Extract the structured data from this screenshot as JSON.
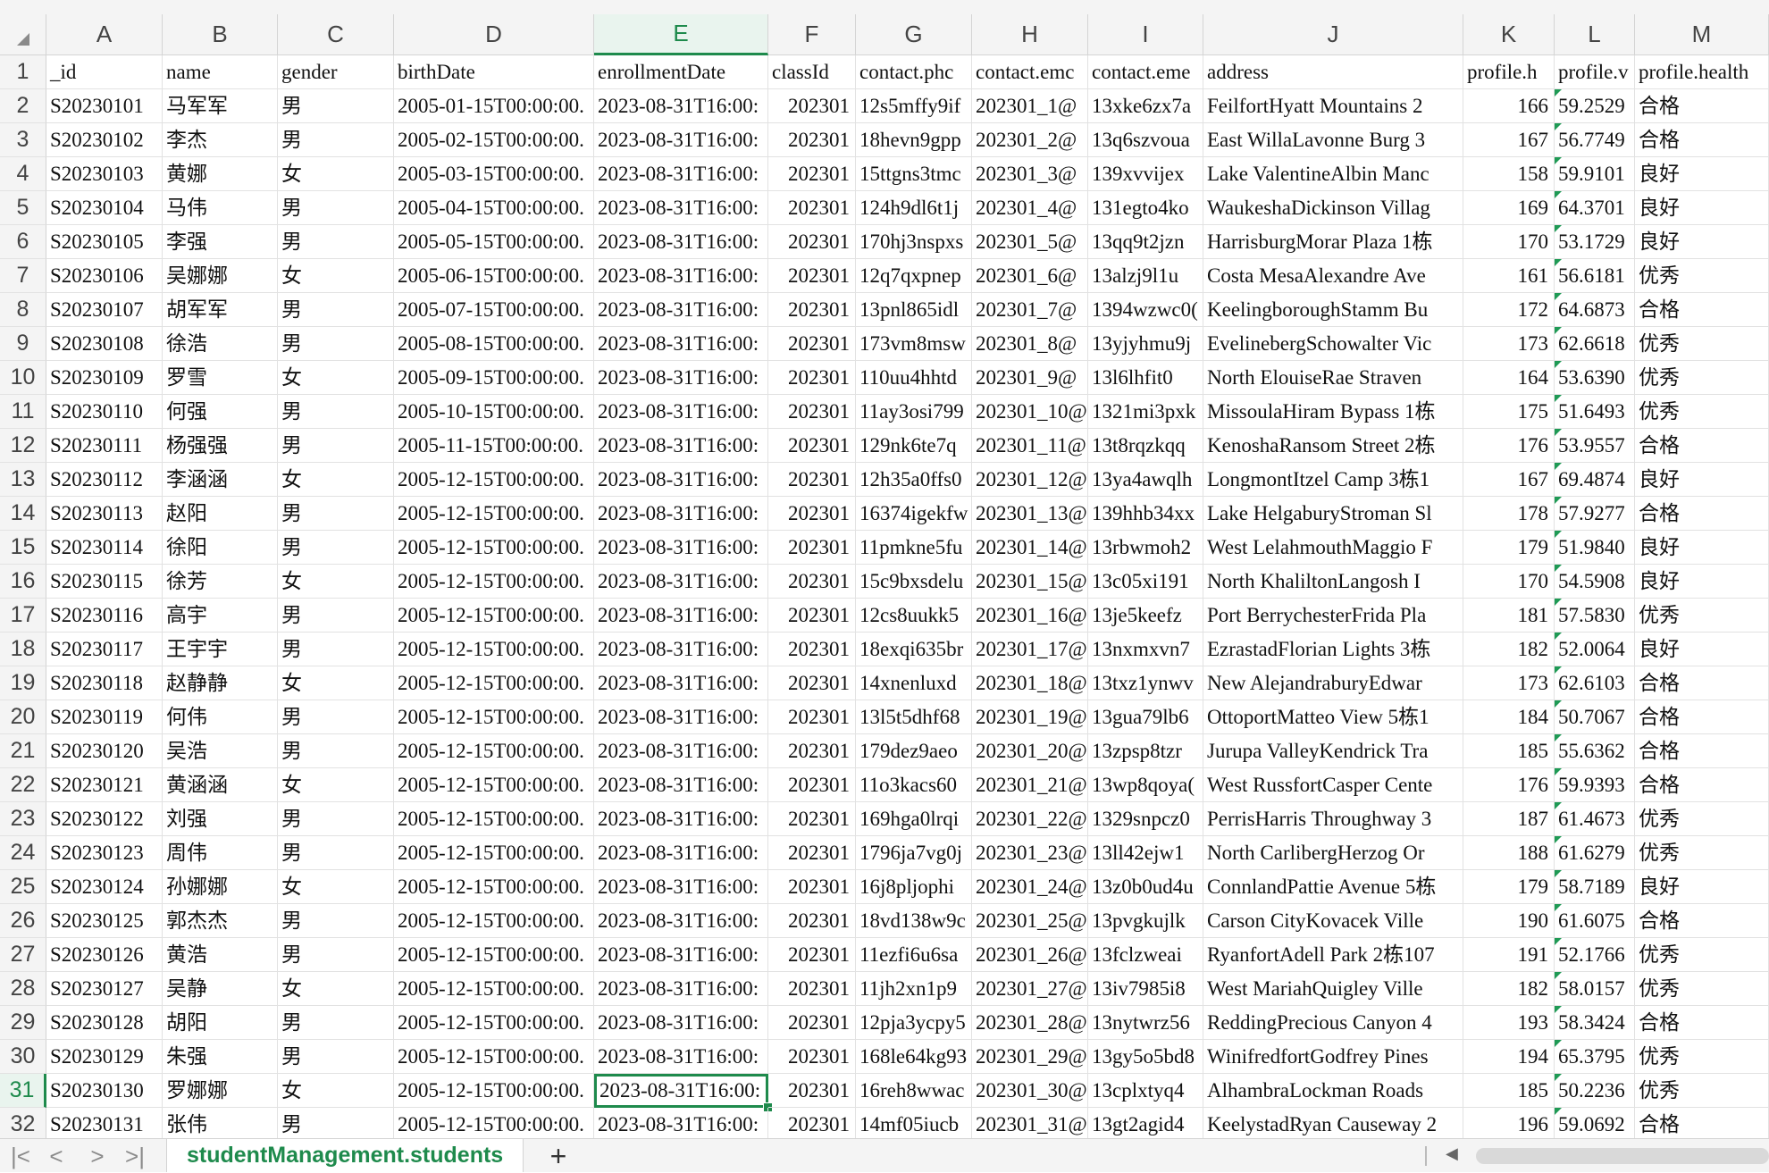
{
  "columns": [
    "A",
    "B",
    "C",
    "D",
    "E",
    "F",
    "G",
    "H",
    "I",
    "J",
    "K",
    "L",
    "M"
  ],
  "selected_column": "E",
  "selected_row": "31",
  "header_row": {
    "row_number": "1",
    "values": [
      "_id",
      "name",
      "gender",
      "birthDate",
      "enrollmentDate",
      "classId",
      "contact.phc",
      "contact.emc",
      "contact.eme",
      "address",
      "profile.h",
      "profile.v",
      "profile.health"
    ]
  },
  "rows": [
    {
      "n": "2",
      "v": [
        "S20230101",
        "马军军",
        "男",
        "2005-01-15T00:00:00.",
        "2023-08-31T16:00:",
        "202301",
        "12s5mffy9if",
        "202301_1@",
        "13xke6zx7a",
        "FeilfortHyatt Mountains 2",
        "166",
        "59.2529",
        "合格"
      ]
    },
    {
      "n": "3",
      "v": [
        "S20230102",
        "李杰",
        "男",
        "2005-02-15T00:00:00.",
        "2023-08-31T16:00:",
        "202301",
        "18hevn9gpp",
        "202301_2@",
        "13q6szvoua",
        "East WillaLavonne Burg 3",
        "167",
        "56.7749",
        "合格"
      ]
    },
    {
      "n": "4",
      "v": [
        "S20230103",
        "黄娜",
        "女",
        "2005-03-15T00:00:00.",
        "2023-08-31T16:00:",
        "202301",
        "15ttgns3tmc",
        "202301_3@",
        "139xvvijex",
        "Lake ValentineAlbin Manc",
        "158",
        "59.9101",
        "良好"
      ]
    },
    {
      "n": "5",
      "v": [
        "S20230104",
        "马伟",
        "男",
        "2005-04-15T00:00:00.",
        "2023-08-31T16:00:",
        "202301",
        "124h9dl6t1j",
        "202301_4@",
        "131egto4ko",
        "WaukeshaDickinson Villag",
        "169",
        "64.3701",
        "良好"
      ]
    },
    {
      "n": "6",
      "v": [
        "S20230105",
        "李强",
        "男",
        "2005-05-15T00:00:00.",
        "2023-08-31T16:00:",
        "202301",
        "170hj3nspxs",
        "202301_5@",
        "13qq9t2jzn",
        "HarrisburgMorar Plaza 1栋",
        "170",
        "53.1729",
        "良好"
      ]
    },
    {
      "n": "7",
      "v": [
        "S20230106",
        "吴娜娜",
        "女",
        "2005-06-15T00:00:00.",
        "2023-08-31T16:00:",
        "202301",
        "12q7qxpnep",
        "202301_6@",
        "13alzj9l1u",
        "Costa MesaAlexandre Ave",
        "161",
        "56.6181",
        "优秀"
      ]
    },
    {
      "n": "8",
      "v": [
        "S20230107",
        "胡军军",
        "男",
        "2005-07-15T00:00:00.",
        "2023-08-31T16:00:",
        "202301",
        "13pnl865idl",
        "202301_7@",
        "1394wzwc0(",
        "KeelingboroughStamm Bu",
        "172",
        "64.6873",
        "合格"
      ]
    },
    {
      "n": "9",
      "v": [
        "S20230108",
        "徐浩",
        "男",
        "2005-08-15T00:00:00.",
        "2023-08-31T16:00:",
        "202301",
        "173vm8msw",
        "202301_8@",
        "13yjyhmu9j",
        "EvelinebergSchowalter Vic",
        "173",
        "62.6618",
        "优秀"
      ]
    },
    {
      "n": "10",
      "v": [
        "S20230109",
        "罗雪",
        "女",
        "2005-09-15T00:00:00.",
        "2023-08-31T16:00:",
        "202301",
        "110uu4hhtd",
        "202301_9@",
        "13l6lhfit0",
        "North ElouiseRae Straven",
        "164",
        "53.6390",
        "优秀"
      ]
    },
    {
      "n": "11",
      "v": [
        "S20230110",
        "何强",
        "男",
        "2005-10-15T00:00:00.",
        "2023-08-31T16:00:",
        "202301",
        "11ay3osi799",
        "202301_10@",
        "1321mi3pxk",
        "MissoulaHiram Bypass 1栋",
        "175",
        "51.6493",
        "优秀"
      ]
    },
    {
      "n": "12",
      "v": [
        "S20230111",
        "杨强强",
        "男",
        "2005-11-15T00:00:00.",
        "2023-08-31T16:00:",
        "202301",
        "129nk6te7q",
        "202301_11@",
        "13t8rqzkqq",
        "KenoshaRansom Street 2栋",
        "176",
        "53.9557",
        "合格"
      ]
    },
    {
      "n": "13",
      "v": [
        "S20230112",
        "李涵涵",
        "女",
        "2005-12-15T00:00:00.",
        "2023-08-31T16:00:",
        "202301",
        "12h35a0ffs0",
        "202301_12@",
        "13ya4awqlh",
        "LongmontItzel Camp 3栋1",
        "167",
        "69.4874",
        "良好"
      ]
    },
    {
      "n": "14",
      "v": [
        "S20230113",
        "赵阳",
        "男",
        "2005-12-15T00:00:00.",
        "2023-08-31T16:00:",
        "202301",
        "16374igekfw",
        "202301_13@",
        "139hhb34xx",
        "Lake HelgaburyStroman Sl",
        "178",
        "57.9277",
        "合格"
      ]
    },
    {
      "n": "15",
      "v": [
        "S20230114",
        "徐阳",
        "男",
        "2005-12-15T00:00:00.",
        "2023-08-31T16:00:",
        "202301",
        "11pmkne5fu",
        "202301_14@",
        "13rbwmoh2",
        "West LelahmouthMaggio F",
        "179",
        "51.9840",
        "良好"
      ]
    },
    {
      "n": "16",
      "v": [
        "S20230115",
        "徐芳",
        "女",
        "2005-12-15T00:00:00.",
        "2023-08-31T16:00:",
        "202301",
        "15c9bxsdelu",
        "202301_15@",
        "13c05xi191",
        "North KhaliltonLangosh I",
        "170",
        "54.5908",
        "良好"
      ]
    },
    {
      "n": "17",
      "v": [
        "S20230116",
        "高宇",
        "男",
        "2005-12-15T00:00:00.",
        "2023-08-31T16:00:",
        "202301",
        "12cs8uukk5",
        "202301_16@",
        "13je5keefz",
        "Port BerrychesterFrida Pla",
        "181",
        "57.5830",
        "优秀"
      ]
    },
    {
      "n": "18",
      "v": [
        "S20230117",
        "王宇宇",
        "男",
        "2005-12-15T00:00:00.",
        "2023-08-31T16:00:",
        "202301",
        "18exqi635br",
        "202301_17@",
        "13nxmxvn7",
        "EzrastadFlorian Lights 3栋",
        "182",
        "52.0064",
        "良好"
      ]
    },
    {
      "n": "19",
      "v": [
        "S20230118",
        "赵静静",
        "女",
        "2005-12-15T00:00:00.",
        "2023-08-31T16:00:",
        "202301",
        "14xnenluxd",
        "202301_18@",
        "13txz1ynwv",
        "New AlejandraburyEdwar",
        "173",
        "62.6103",
        "合格"
      ]
    },
    {
      "n": "20",
      "v": [
        "S20230119",
        "何伟",
        "男",
        "2005-12-15T00:00:00.",
        "2023-08-31T16:00:",
        "202301",
        "13l5t5dhf68",
        "202301_19@",
        "13gua79lb6",
        "OttoportMatteo View 5栋1",
        "184",
        "50.7067",
        "合格"
      ]
    },
    {
      "n": "21",
      "v": [
        "S20230120",
        "吴浩",
        "男",
        "2005-12-15T00:00:00.",
        "2023-08-31T16:00:",
        "202301",
        "179dez9aeo",
        "202301_20@",
        "13zpsp8tzr",
        "Jurupa ValleyKendrick Tra",
        "185",
        "55.6362",
        "合格"
      ]
    },
    {
      "n": "22",
      "v": [
        "S20230121",
        "黄涵涵",
        "女",
        "2005-12-15T00:00:00.",
        "2023-08-31T16:00:",
        "202301",
        "11o3kacs60",
        "202301_21@",
        "13wp8qoya(",
        "West RussfortCasper Cente",
        "176",
        "59.9393",
        "合格"
      ]
    },
    {
      "n": "23",
      "v": [
        "S20230122",
        "刘强",
        "男",
        "2005-12-15T00:00:00.",
        "2023-08-31T16:00:",
        "202301",
        "169hga0lrqi",
        "202301_22@",
        "1329snpcz0",
        "PerrisHarris Throughway 3",
        "187",
        "61.4673",
        "优秀"
      ]
    },
    {
      "n": "24",
      "v": [
        "S20230123",
        "周伟",
        "男",
        "2005-12-15T00:00:00.",
        "2023-08-31T16:00:",
        "202301",
        "1796ja7vg0j",
        "202301_23@",
        "13ll42ejw1",
        "North CarlibergHerzog Or",
        "188",
        "61.6279",
        "优秀"
      ]
    },
    {
      "n": "25",
      "v": [
        "S20230124",
        "孙娜娜",
        "女",
        "2005-12-15T00:00:00.",
        "2023-08-31T16:00:",
        "202301",
        "16j8pljophi",
        "202301_24@",
        "13z0b0ud4u",
        "ConnlandPattie Avenue 5栋",
        "179",
        "58.7189",
        "良好"
      ]
    },
    {
      "n": "26",
      "v": [
        "S20230125",
        "郭杰杰",
        "男",
        "2005-12-15T00:00:00.",
        "2023-08-31T16:00:",
        "202301",
        "18vd138w9c",
        "202301_25@",
        "13pvgkujlk",
        "Carson CityKovacek Ville",
        "190",
        "61.6075",
        "合格"
      ]
    },
    {
      "n": "27",
      "v": [
        "S20230126",
        "黄浩",
        "男",
        "2005-12-15T00:00:00.",
        "2023-08-31T16:00:",
        "202301",
        "11ezfi6u6sa",
        "202301_26@",
        "13fclzweai",
        "RyanfortAdell Park 2栋107",
        "191",
        "52.1766",
        "优秀"
      ]
    },
    {
      "n": "28",
      "v": [
        "S20230127",
        "吴静",
        "女",
        "2005-12-15T00:00:00.",
        "2023-08-31T16:00:",
        "202301",
        "11jh2xn1p9",
        "202301_27@",
        "13iv7985i8",
        "West MariahQuigley Ville",
        "182",
        "58.0157",
        "优秀"
      ]
    },
    {
      "n": "29",
      "v": [
        "S20230128",
        "胡阳",
        "男",
        "2005-12-15T00:00:00.",
        "2023-08-31T16:00:",
        "202301",
        "12pja3ycpy5",
        "202301_28@",
        "13nytwrz56",
        "ReddingPrecious Canyon 4",
        "193",
        "58.3424",
        "合格"
      ]
    },
    {
      "n": "30",
      "v": [
        "S20230129",
        "朱强",
        "男",
        "2005-12-15T00:00:00.",
        "2023-08-31T16:00:",
        "202301",
        "168le64kg93",
        "202301_29@",
        "13gy5o5bd8",
        "WinifredfortGodfrey Pines",
        "194",
        "65.3795",
        "优秀"
      ]
    },
    {
      "n": "31",
      "v": [
        "S20230130",
        "罗娜娜",
        "女",
        "2005-12-15T00:00:00.",
        "2023-08-31T16:00:",
        "202301",
        "16reh8wwac",
        "202301_30@",
        "13cplxtyq4",
        "AlhambraLockman Roads",
        "185",
        "50.2236",
        "优秀"
      ]
    },
    {
      "n": "32",
      "v": [
        "S20230131",
        "张伟",
        "男",
        "2005-12-15T00:00:00.",
        "2023-08-31T16:00:",
        "202301",
        "14mf05iucb",
        "202301_31@",
        "13gt2agid4",
        "KeelystadRyan Causeway 2",
        "196",
        "59.0692",
        "合格"
      ]
    }
  ],
  "tabbar": {
    "nav": [
      "|<",
      "<",
      ">",
      ">|"
    ],
    "sheet_tab_label": "studentManagement.students",
    "add_tab_label": "+"
  },
  "colors": {
    "accent": "#1e8a4c",
    "header_bg": "#f4f4f4",
    "grid": "#e2e2e2"
  }
}
